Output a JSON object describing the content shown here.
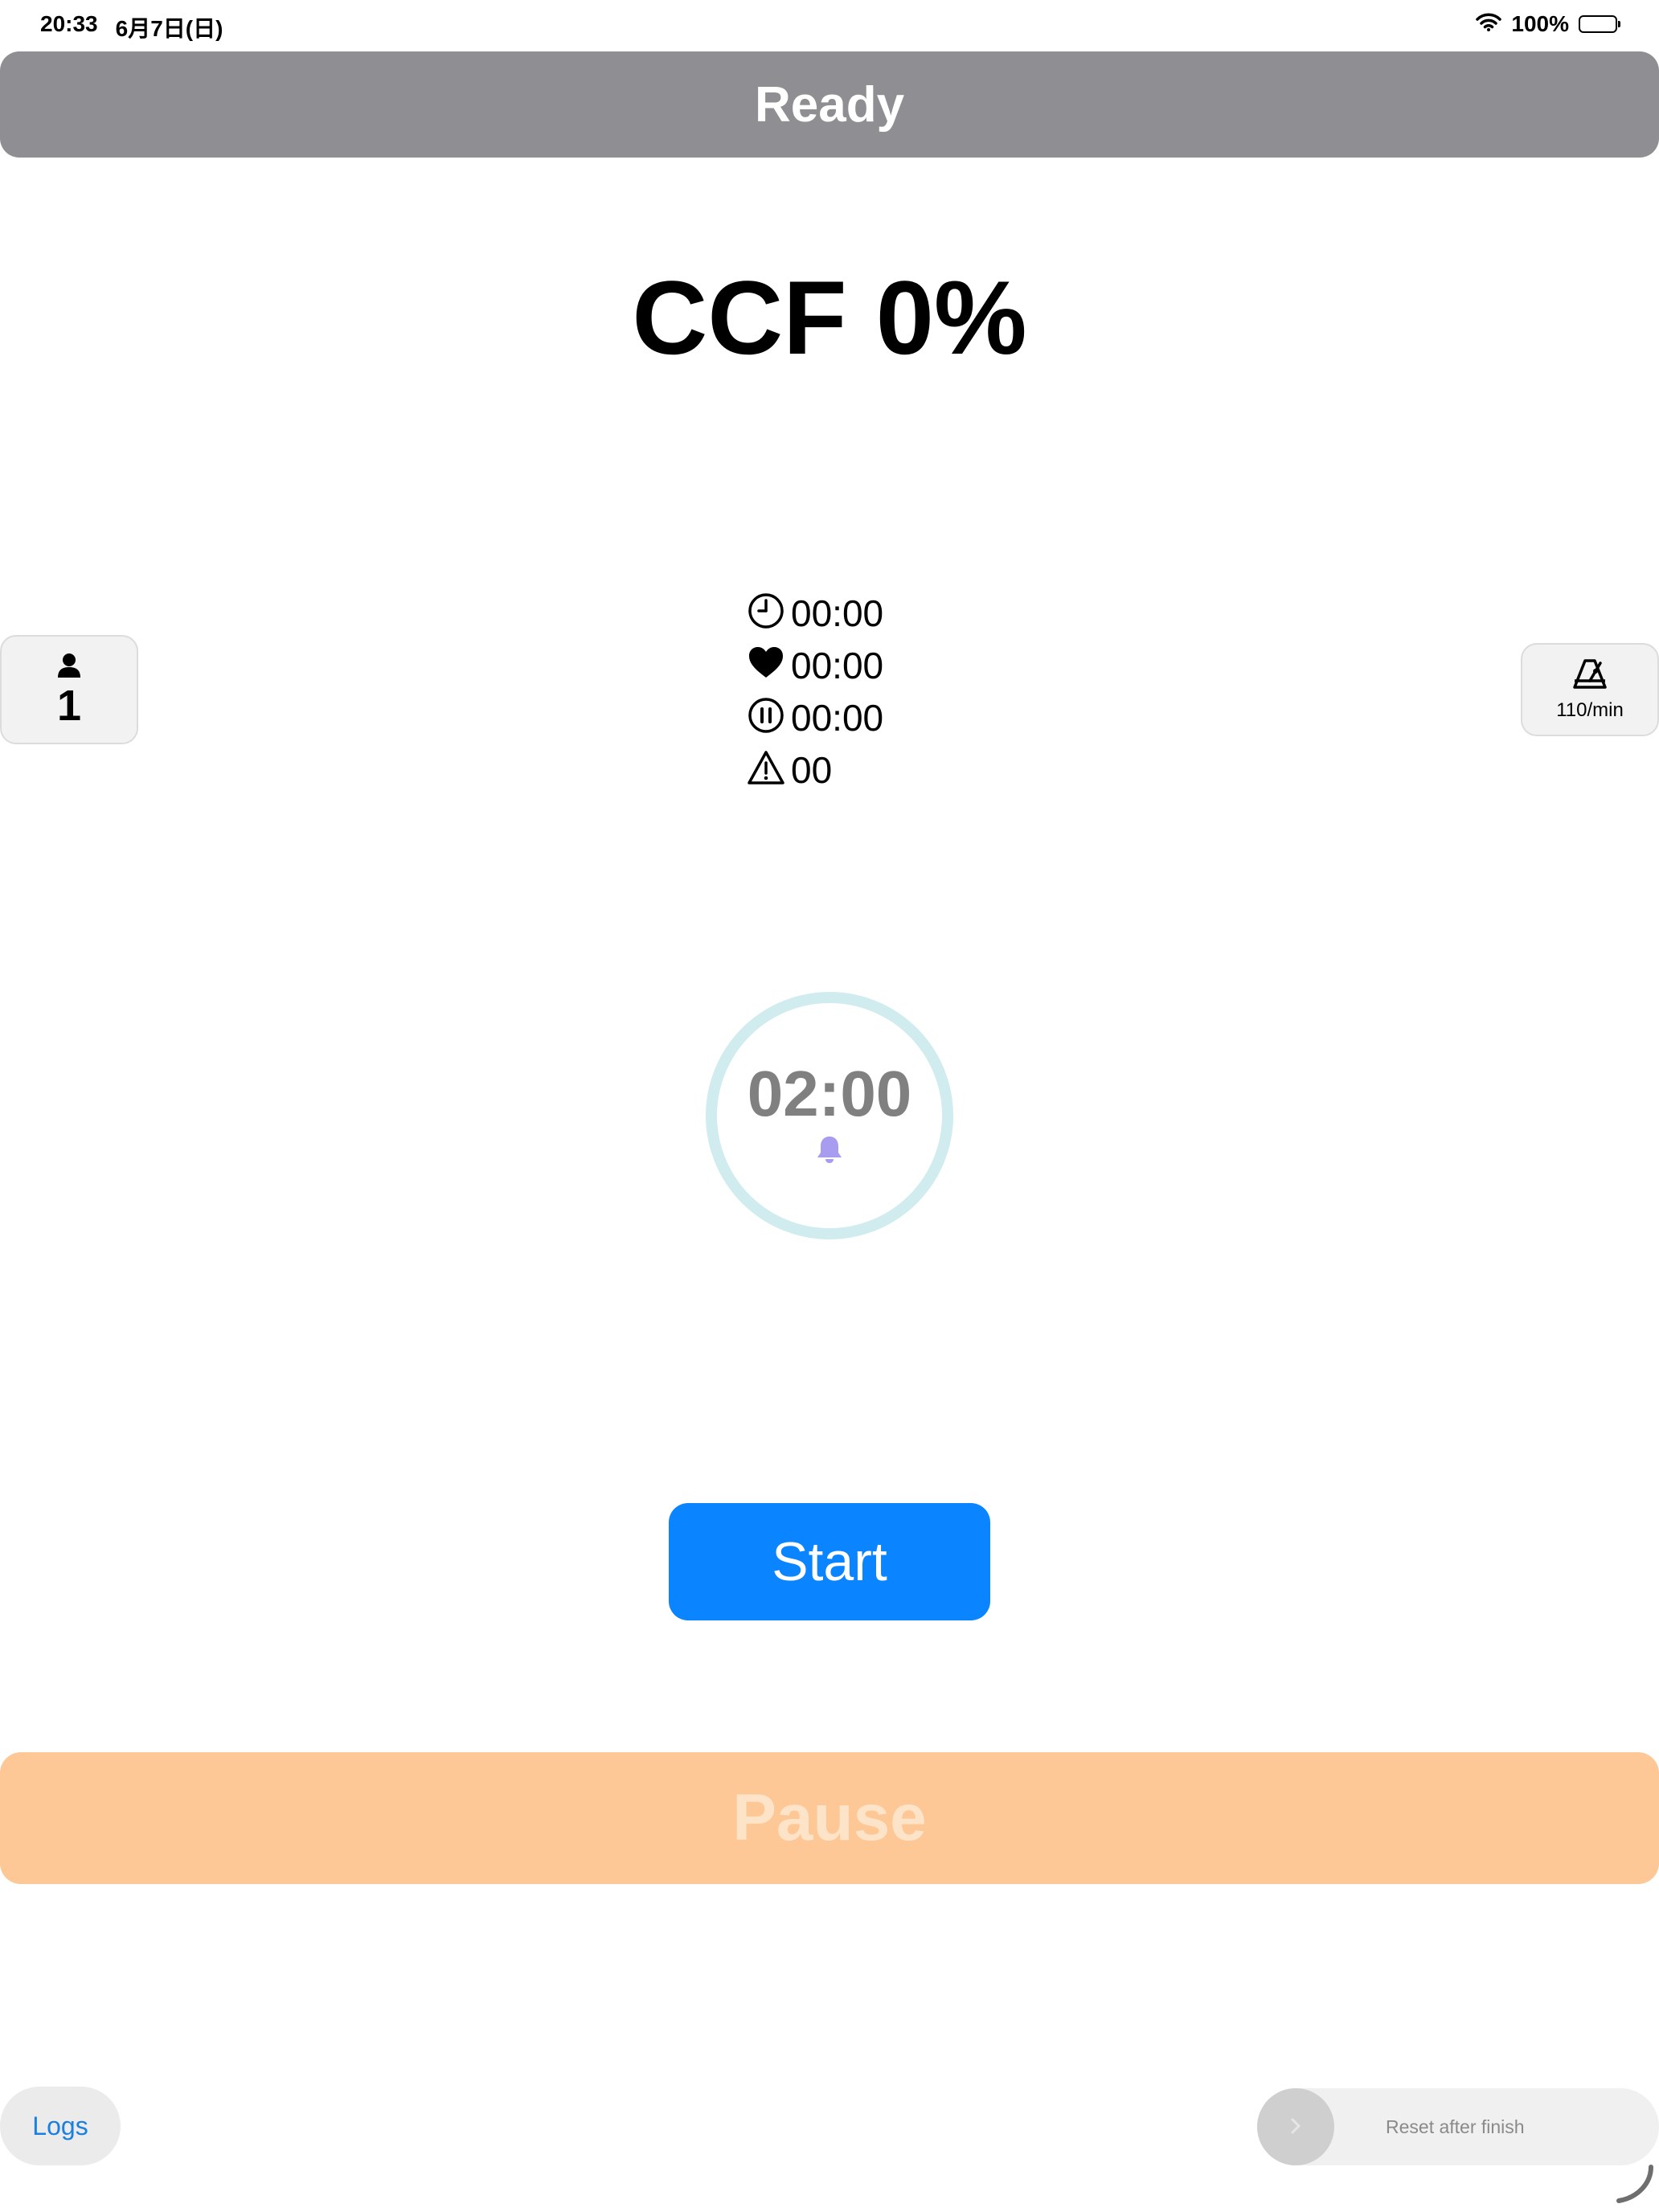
{
  "status_bar": {
    "time": "20:33",
    "date": "6月7日(日)",
    "battery": "100%"
  },
  "header": {
    "state_label": "Ready",
    "state_color": "#8e8e93"
  },
  "ccf": {
    "label": "CCF 0%"
  },
  "rescuer": {
    "count": "1"
  },
  "compression_rate": {
    "label": "110/min"
  },
  "stats": {
    "total_time": "00:00",
    "compression_time": "00:00",
    "pause_time": "00:00",
    "alerts": "00"
  },
  "timer": {
    "value": "02:00",
    "ring_color": "#d1ecef",
    "bell_color": "#a89cf0"
  },
  "buttons": {
    "start": "Start",
    "start_color": "#0a84ff",
    "pause": "Pause",
    "pause_color": "#fdc796",
    "logs": "Logs"
  },
  "reset_slider": {
    "label": "Reset after finish"
  }
}
